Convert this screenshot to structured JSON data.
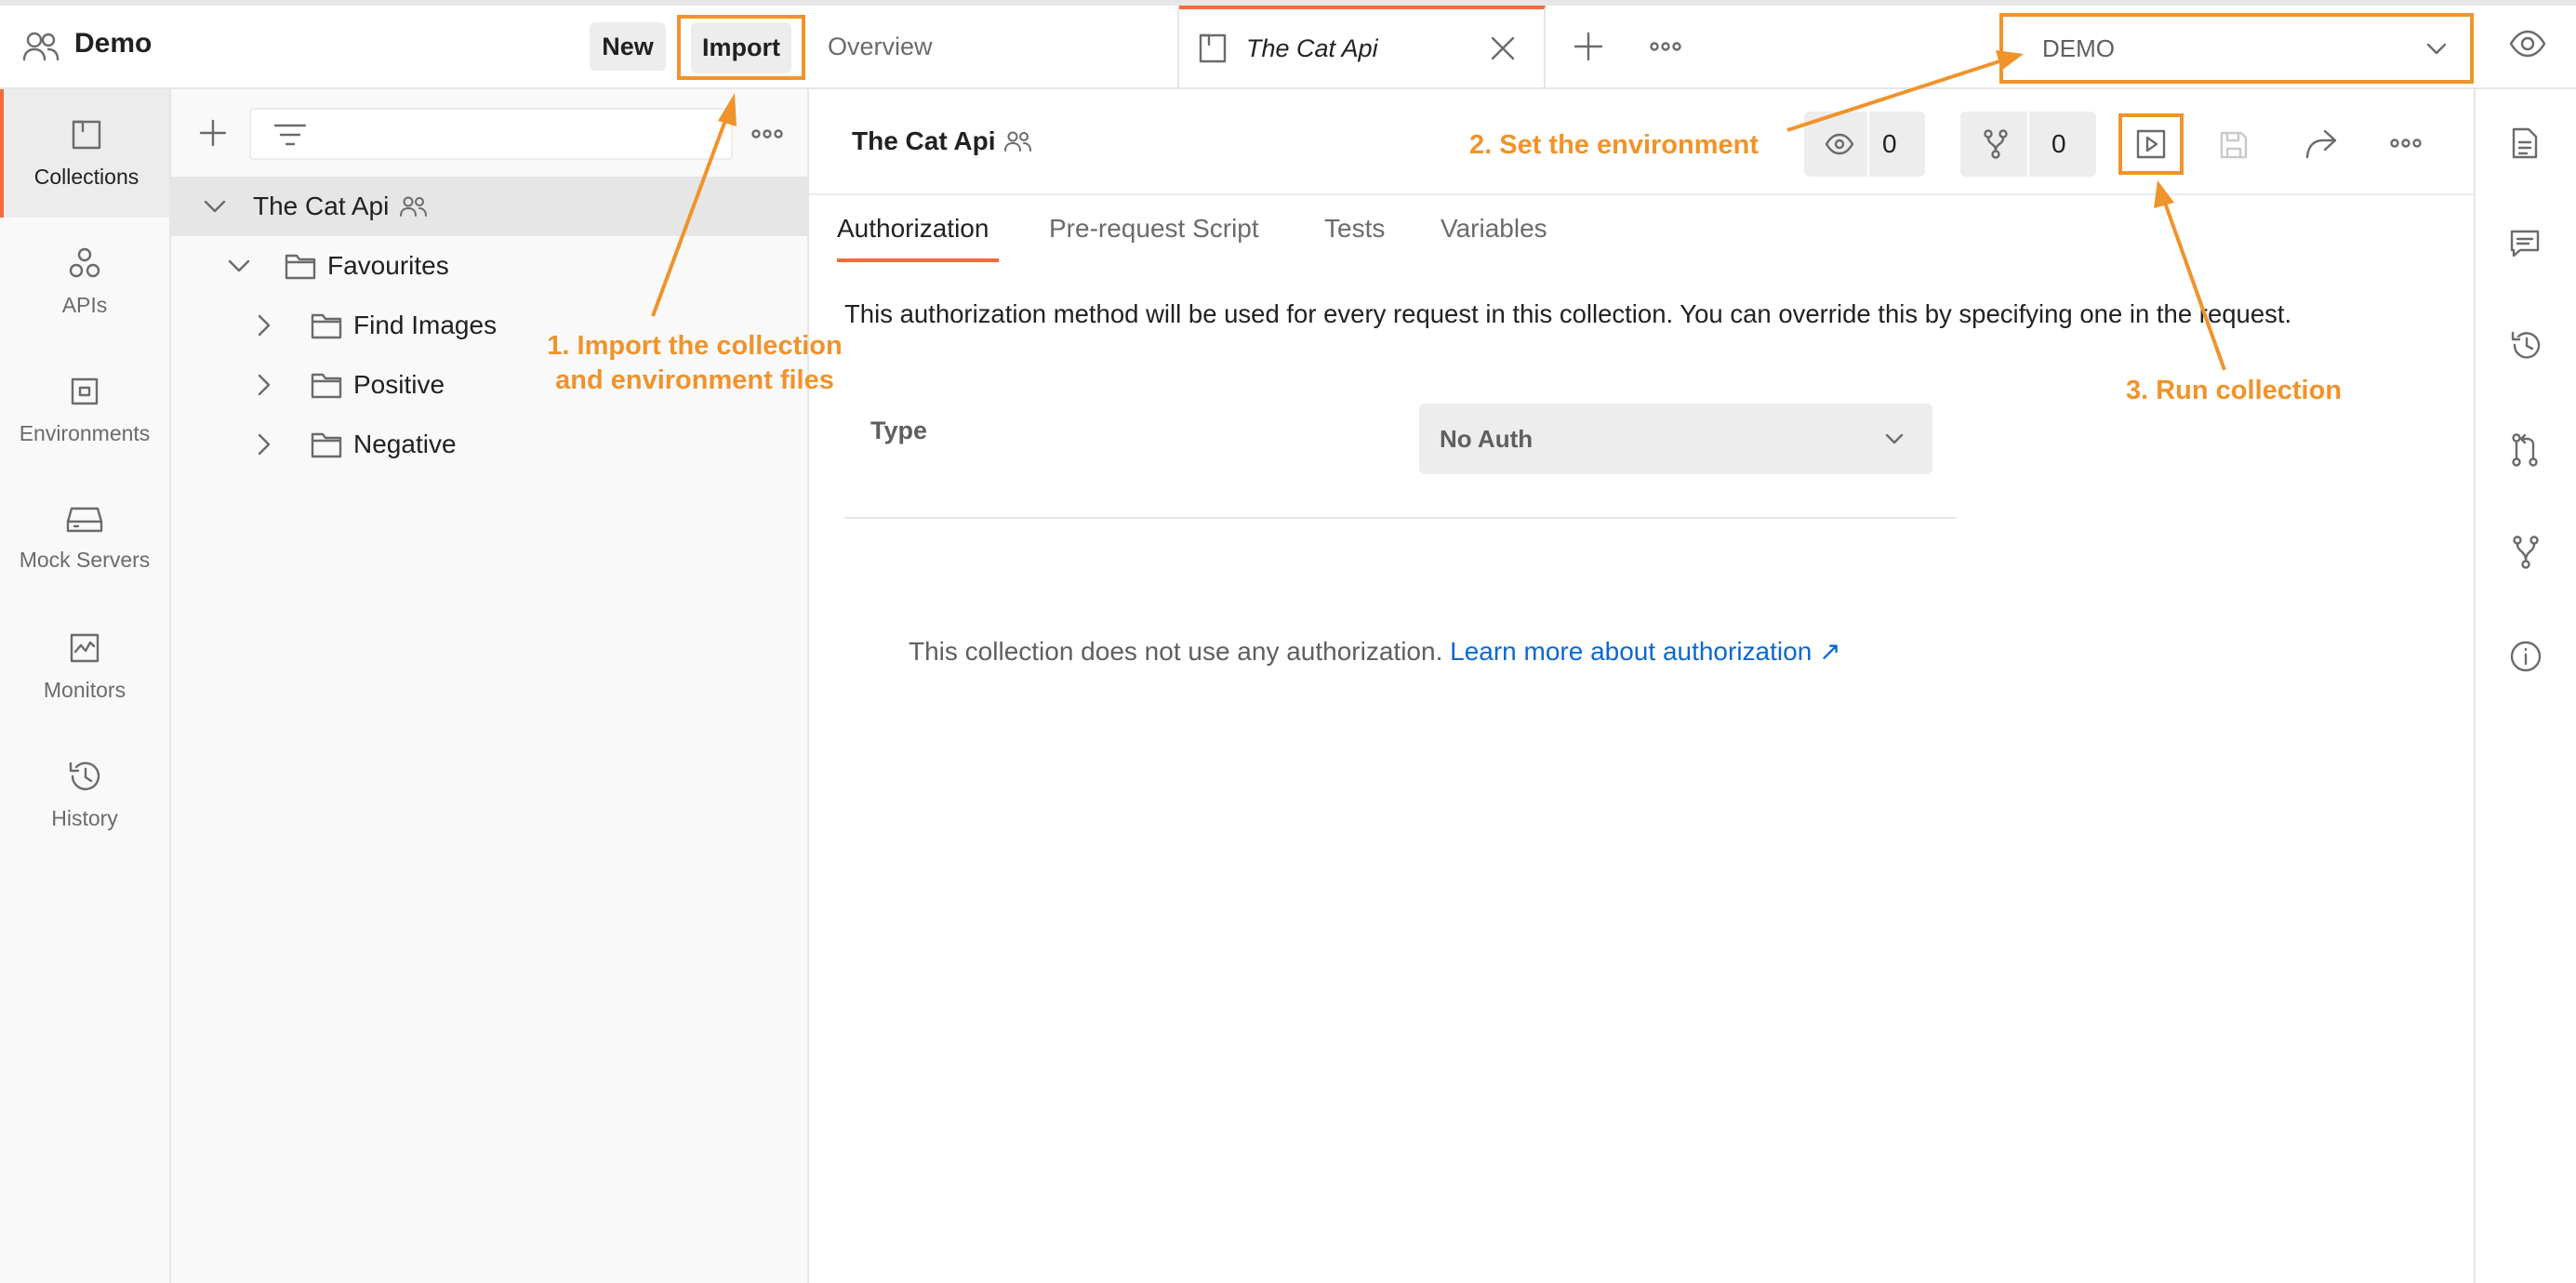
{
  "workspace": {
    "title": "Demo",
    "new_label": "New",
    "import_label": "Import"
  },
  "tabs": [
    {
      "label": "Overview",
      "active": false
    },
    {
      "label": "The Cat Api",
      "active": true
    }
  ],
  "environment": {
    "selected": "DEMO"
  },
  "rail": [
    {
      "label": "Collections",
      "icon": "collections-icon",
      "active": true
    },
    {
      "label": "APIs",
      "icon": "apis-icon"
    },
    {
      "label": "Environments",
      "icon": "environments-icon"
    },
    {
      "label": "Mock Servers",
      "icon": "mock-servers-icon"
    },
    {
      "label": "Monitors",
      "icon": "monitors-icon"
    },
    {
      "label": "History",
      "icon": "history-icon"
    }
  ],
  "tree": [
    {
      "label": "The Cat Api",
      "expanded": true,
      "selected": true
    },
    {
      "label": "Favourites",
      "expanded": true
    },
    {
      "label": "Find Images",
      "expanded": false
    },
    {
      "label": "Positive",
      "expanded": false
    },
    {
      "label": "Negative",
      "expanded": false
    }
  ],
  "collection": {
    "title": "The Cat Api",
    "watch_count": "0",
    "fork_count": "0"
  },
  "subtabs": [
    "Authorization",
    "Pre-request Script",
    "Tests",
    "Variables"
  ],
  "auth": {
    "description": "This authorization method will be used for every request in this collection. You can override this by specifying one in the request.",
    "type_label": "Type",
    "type_value": "No Auth",
    "empty_text": "This collection does not use any authorization.",
    "learn_more": "Learn more about authorization ↗"
  },
  "annotations": {
    "step1_line1": "1. Import the collection",
    "step1_line2": "and environment files",
    "step2": "2. Set the environment",
    "step3": "3. Run collection",
    "color": "#f0932b"
  },
  "colors": {
    "accent": "#f26b3a",
    "link": "#0b68d1"
  }
}
